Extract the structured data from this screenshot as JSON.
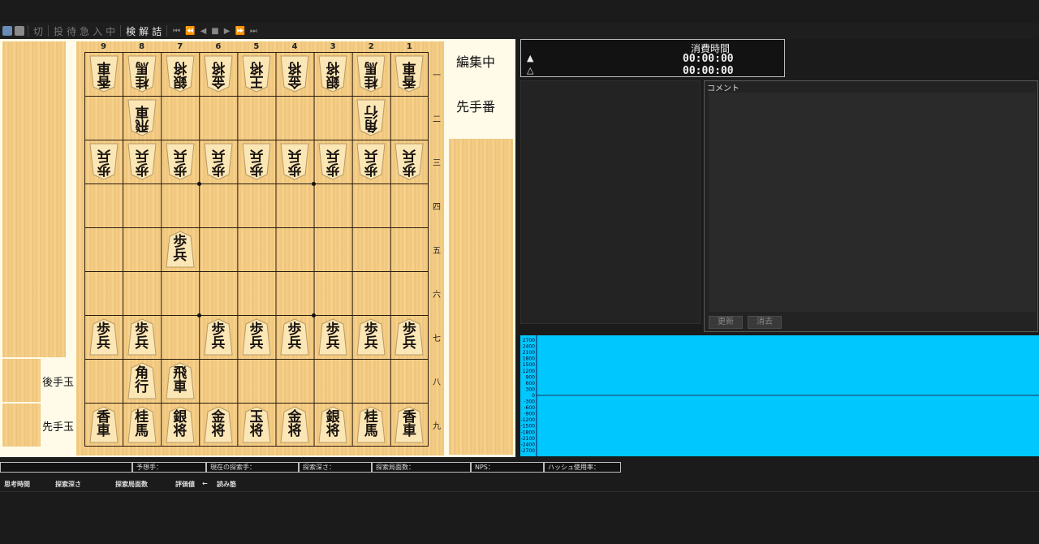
{
  "toolbar": {
    "buttons": [
      "切",
      "投",
      "待",
      "急",
      "入",
      "中",
      "検",
      "解",
      "詰"
    ],
    "nav": [
      "⏮",
      "⏪",
      "◀",
      "■",
      "▶",
      "⏩",
      "⏭"
    ]
  },
  "board": {
    "files": [
      "9",
      "8",
      "7",
      "6",
      "5",
      "4",
      "3",
      "2",
      "1"
    ],
    "ranks": [
      "一",
      "二",
      "三",
      "四",
      "五",
      "六",
      "七",
      "八",
      "九"
    ],
    "pieces": [
      {
        "file": 9,
        "rank": 1,
        "side": "gote",
        "top": "香",
        "bottom": "車"
      },
      {
        "file": 8,
        "rank": 1,
        "side": "gote",
        "top": "桂",
        "bottom": "馬"
      },
      {
        "file": 7,
        "rank": 1,
        "side": "gote",
        "top": "銀",
        "bottom": "将"
      },
      {
        "file": 6,
        "rank": 1,
        "side": "gote",
        "top": "金",
        "bottom": "将"
      },
      {
        "file": 5,
        "rank": 1,
        "side": "gote",
        "top": "王",
        "bottom": "将"
      },
      {
        "file": 4,
        "rank": 1,
        "side": "gote",
        "top": "金",
        "bottom": "将"
      },
      {
        "file": 3,
        "rank": 1,
        "side": "gote",
        "top": "銀",
        "bottom": "将"
      },
      {
        "file": 2,
        "rank": 1,
        "side": "gote",
        "top": "桂",
        "bottom": "馬"
      },
      {
        "file": 1,
        "rank": 1,
        "side": "gote",
        "top": "香",
        "bottom": "車"
      },
      {
        "file": 8,
        "rank": 2,
        "side": "gote",
        "top": "飛",
        "bottom": "車"
      },
      {
        "file": 2,
        "rank": 2,
        "side": "gote",
        "top": "角",
        "bottom": "行"
      },
      {
        "file": 9,
        "rank": 3,
        "side": "gote",
        "top": "歩",
        "bottom": "兵"
      },
      {
        "file": 8,
        "rank": 3,
        "side": "gote",
        "top": "歩",
        "bottom": "兵"
      },
      {
        "file": 7,
        "rank": 3,
        "side": "gote",
        "top": "歩",
        "bottom": "兵"
      },
      {
        "file": 6,
        "rank": 3,
        "side": "gote",
        "top": "歩",
        "bottom": "兵"
      },
      {
        "file": 5,
        "rank": 3,
        "side": "gote",
        "top": "歩",
        "bottom": "兵"
      },
      {
        "file": 4,
        "rank": 3,
        "side": "gote",
        "top": "歩",
        "bottom": "兵"
      },
      {
        "file": 3,
        "rank": 3,
        "side": "gote",
        "top": "歩",
        "bottom": "兵"
      },
      {
        "file": 2,
        "rank": 3,
        "side": "gote",
        "top": "歩",
        "bottom": "兵"
      },
      {
        "file": 1,
        "rank": 3,
        "side": "gote",
        "top": "歩",
        "bottom": "兵"
      },
      {
        "file": 7,
        "rank": 5,
        "side": "sente",
        "top": "歩",
        "bottom": "兵"
      },
      {
        "file": 9,
        "rank": 7,
        "side": "sente",
        "top": "歩",
        "bottom": "兵"
      },
      {
        "file": 8,
        "rank": 7,
        "side": "sente",
        "top": "歩",
        "bottom": "兵"
      },
      {
        "file": 6,
        "rank": 7,
        "side": "sente",
        "top": "歩",
        "bottom": "兵"
      },
      {
        "file": 5,
        "rank": 7,
        "side": "sente",
        "top": "歩",
        "bottom": "兵"
      },
      {
        "file": 4,
        "rank": 7,
        "side": "sente",
        "top": "歩",
        "bottom": "兵"
      },
      {
        "file": 3,
        "rank": 7,
        "side": "sente",
        "top": "歩",
        "bottom": "兵"
      },
      {
        "file": 2,
        "rank": 7,
        "side": "sente",
        "top": "歩",
        "bottom": "兵"
      },
      {
        "file": 1,
        "rank": 7,
        "side": "sente",
        "top": "歩",
        "bottom": "兵"
      },
      {
        "file": 8,
        "rank": 8,
        "side": "sente",
        "top": "角",
        "bottom": "行"
      },
      {
        "file": 7,
        "rank": 8,
        "side": "sente",
        "top": "飛",
        "bottom": "車"
      },
      {
        "file": 9,
        "rank": 9,
        "side": "sente",
        "top": "香",
        "bottom": "車"
      },
      {
        "file": 8,
        "rank": 9,
        "side": "sente",
        "top": "桂",
        "bottom": "馬"
      },
      {
        "file": 7,
        "rank": 9,
        "side": "sente",
        "top": "銀",
        "bottom": "将"
      },
      {
        "file": 6,
        "rank": 9,
        "side": "sente",
        "top": "金",
        "bottom": "将"
      },
      {
        "file": 5,
        "rank": 9,
        "side": "sente",
        "top": "玉",
        "bottom": "将"
      },
      {
        "file": 4,
        "rank": 9,
        "side": "sente",
        "top": "金",
        "bottom": "将"
      },
      {
        "file": 3,
        "rank": 9,
        "side": "sente",
        "top": "銀",
        "bottom": "将"
      },
      {
        "file": 2,
        "rank": 9,
        "side": "sente",
        "top": "桂",
        "bottom": "馬"
      },
      {
        "file": 1,
        "rank": 9,
        "side": "sente",
        "top": "香",
        "bottom": "車"
      }
    ]
  },
  "labels": {
    "gote_hand": "後手玉",
    "sente_hand": "先手玉",
    "edit_status": "編集中",
    "turn": "先手番"
  },
  "time": {
    "title": "消費時間",
    "sente_symbol": "▲",
    "sente_time": "00:00:00",
    "gote_symbol": "△",
    "gote_time": "00:00:00"
  },
  "comment": {
    "label": "コメント",
    "update_button": "更新",
    "clear_button": "消去"
  },
  "eval_graph": {
    "y_labels": [
      "2700",
      "2400",
      "2100",
      "1800",
      "1500",
      "1200",
      "900",
      "600",
      "300",
      "0",
      "-300",
      "-600",
      "-900",
      "-1200",
      "-1500",
      "-1800",
      "-2100",
      "-2400",
      "-2700"
    ]
  },
  "engine_info": {
    "cells": [
      "",
      "予想手：",
      "現在の探索手：",
      "探索深さ：",
      "探索局面数：",
      "NPS：",
      "ハッシュ使用率："
    ]
  },
  "pv_columns": [
    "思考時間",
    "探索深さ",
    "探索局面数",
    "評価値",
    "←",
    "読み筋"
  ],
  "colors": {
    "graph_bg": "#00c8ff",
    "board_wood": "#f4cd84",
    "panel_bg": "#232323"
  }
}
